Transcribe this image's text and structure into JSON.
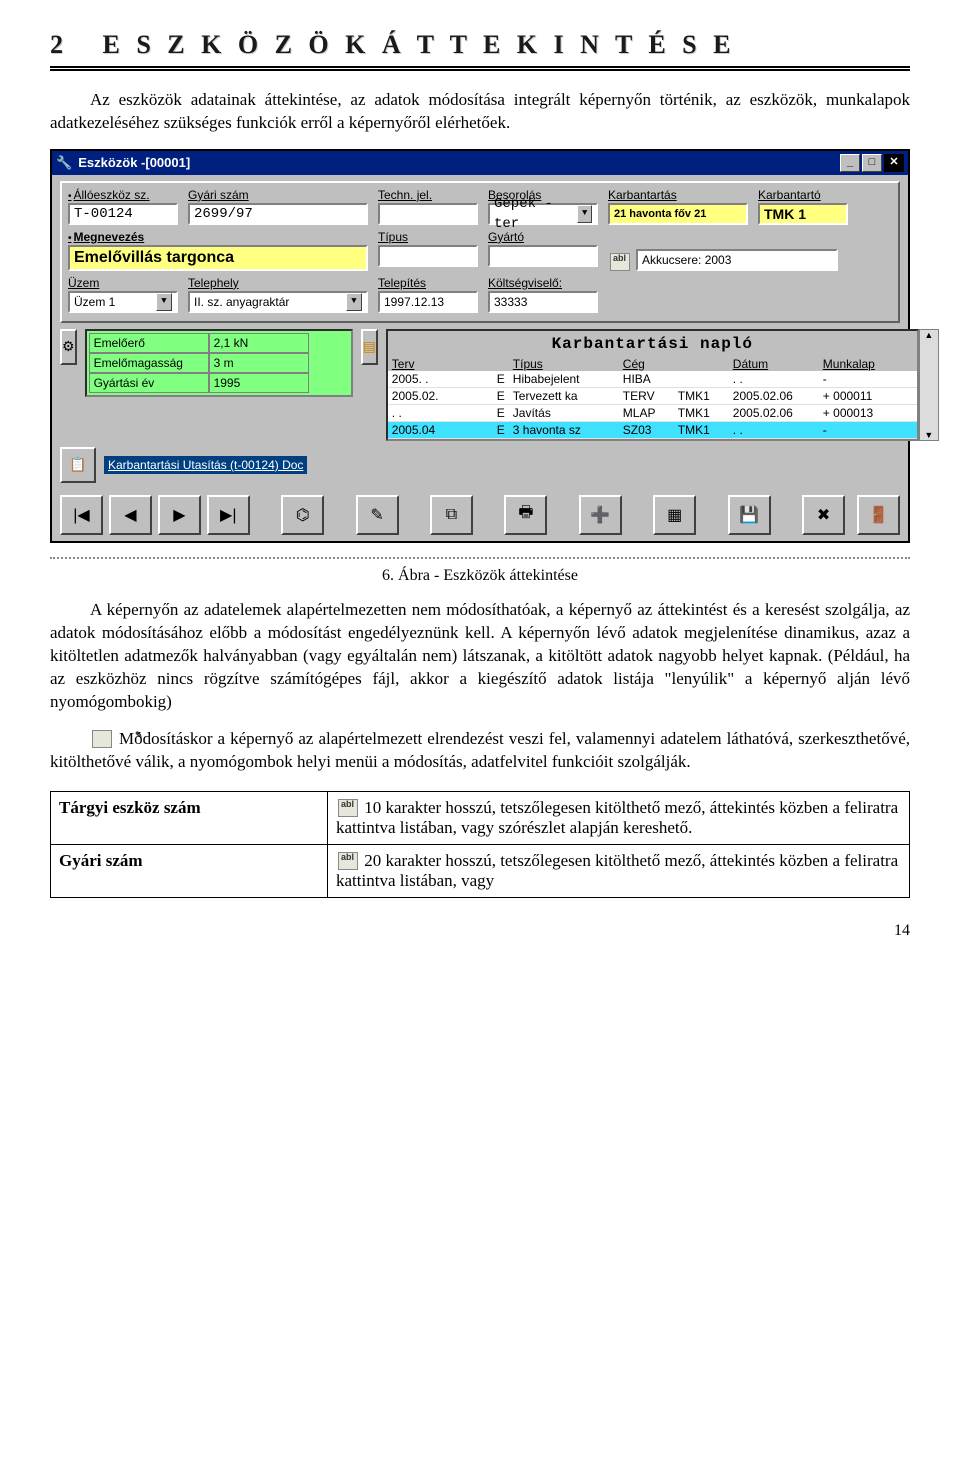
{
  "chapter": {
    "number": "2",
    "title_plain": "ESZKÖZÖK ÁTTEKINTÉSE",
    "title_letters": "E S Z K Ö Z Ö K   Á T T E K I N T É S E"
  },
  "intro": {
    "p1": "Az eszközök adatainak áttekintése, az adatok módosítása integrált képernyőn történik, az eszközök, munkalapok adatkezeléséhez szükséges funkciók erről a képernyőről elérhetőek."
  },
  "app": {
    "title": "Eszközök -[00001]",
    "titlebar_icon": "wrench-icon",
    "win_buttons": [
      "minimize",
      "maximize",
      "close"
    ],
    "fields": {
      "alloeszkoz_label": "Állóeszköz sz.",
      "alloeszkoz_value": "T-00124",
      "gyari_label": "Gyári szám",
      "gyari_value": "2699/97",
      "techn_label": "Techn. jel.",
      "techn_value": "",
      "besorolas_label": "Besorolás",
      "besorolas_value": "Gépek - ter",
      "karbantartas_label": "Karbantartás",
      "karbantartas_value": "21 havonta főv 21",
      "karbantarto_label": "Karbantartó",
      "karbantarto_value": "TMK 1",
      "megnevezes_label": "Megnevezés",
      "megnevezes_value": "Emelővillás targonca",
      "tipus_label": "Típus",
      "tipus_value": "",
      "gyarto_label": "Gyártó",
      "gyarto_value": "",
      "extra_note": "Akkucsere: 2003",
      "uzem_label": "Üzem",
      "uzem_value": "Üzem 1",
      "telephely_label": "Telephely",
      "telephely_value": "II. sz. anyagraktár",
      "telepites_label": "Telepítés",
      "telepites_value": "1997.12.13",
      "koltseg_label": "Költségviselő:",
      "koltseg_value": "33333"
    },
    "props": [
      {
        "k": "Emelőerő",
        "v": "2,1 kN"
      },
      {
        "k": "Emelőmagasság",
        "v": "3 m"
      },
      {
        "k": "Gyártási év",
        "v": "1995"
      }
    ],
    "log": {
      "title": "Karbantartási napló",
      "cols": [
        "Terv",
        "",
        "Típus",
        "Cég",
        "",
        "Dátum",
        "Munkalap"
      ],
      "head_cols": [
        "Terv",
        "Típus  Cég",
        "Dátum",
        "Munkalap"
      ],
      "rows": [
        {
          "c": [
            "2005. .",
            "E",
            "Hibabejelent",
            "HIBA",
            "",
            "  . .",
            "-"
          ]
        },
        {
          "c": [
            "2005.02.",
            "E",
            "Tervezett ka",
            "TERV",
            "TMK1",
            "2005.02.06",
            "+ 000011"
          ]
        },
        {
          "c": [
            "  . .",
            "E",
            "Javítás",
            "MLAP",
            "TMK1",
            "2005.02.06",
            "+ 000013"
          ]
        },
        {
          "c": [
            "2005.04",
            "E",
            "3 havonta sz",
            "SZ03",
            "TMK1",
            "  . .",
            "-"
          ],
          "selected": true
        }
      ]
    },
    "doc_link": "Karbantartási Utasítás (t-00124) Doc"
  },
  "caption": "6. Ábra - Eszközök áttekintése",
  "paras": {
    "p2": "A képernyőn az adatelemek alapértelmezetten nem módosíthatóak, a képernyő az áttekintést és a keresést szolgálja, az adatok módosításához előbb a módosítást engedélyeznünk kell. A képernyőn lévő adatok megjelenítése dinamikus, azaz a kitöltetlen adatmezők halványabban (vagy egyáltalán nem) látszanak, a kitöltött adatok nagyobb helyet kapnak. (Például, ha az eszközhöz nincs rögzítve számítógépes fájl, akkor a kiegészítő adatok listája \"lenyúlik\" a képernyő alján lévő nyomógombokig)",
    "p3": "Módosításkor a képernyő az alapértelmezett elrendezést veszi fel, valamennyi adatelem láthatóvá, szerkeszthetővé, kitölthetővé válik, a nyomógombok helyi menüi a módosítás, adatfelvitel funkcióit szolgálják."
  },
  "table": {
    "r1_key": "Tárgyi eszköz szám",
    "r1_lead": "10 karakter hosszú, tetszőlegesen kitölthető mező, áttekintés közben a feliratra kattintva listában, vagy szórészlet alapján kereshető.",
    "r2_key": "Gyári szám",
    "r2_lead": "20 karakter hosszú, tetszőlegesen kitölthető mező, áttekintés közben a feliratra kattintva listában, vagy"
  },
  "page_number": "14"
}
